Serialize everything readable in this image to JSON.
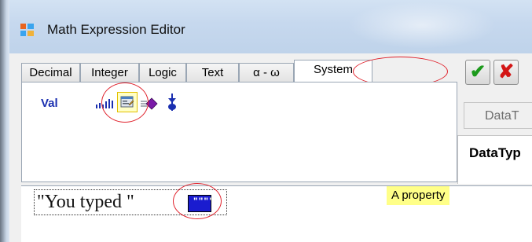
{
  "window": {
    "title": "Math Expression Editor"
  },
  "tabs": [
    {
      "label": "Decimal",
      "selected": false
    },
    {
      "label": "Integer",
      "selected": false
    },
    {
      "label": "Logic",
      "selected": false
    },
    {
      "label": "Text",
      "selected": false
    },
    {
      "label": "α - ω",
      "selected": false
    },
    {
      "label": "System",
      "selected": true
    }
  ],
  "tab_panel": {
    "val_label": "Val",
    "icons": [
      "bars-icon",
      "property-icon",
      "purple-diamond-icon",
      "blue-stem-icon"
    ]
  },
  "toolbar": {
    "ok_symbol": "✔",
    "cancel_symbol": "✘"
  },
  "side_panel": {
    "tab_label": "DataT",
    "header_label": "DataTyp"
  },
  "editor": {
    "expression_text": "\"You typed \"",
    "property_block_symbol": "\"\"\"\""
  },
  "tooltip": {
    "text": "A property"
  },
  "colors": {
    "annotation": "#e0222c",
    "tooltip_bg": "#ffff88",
    "val_label": "#1a2fb0",
    "property_block": "#1a1ccf"
  }
}
